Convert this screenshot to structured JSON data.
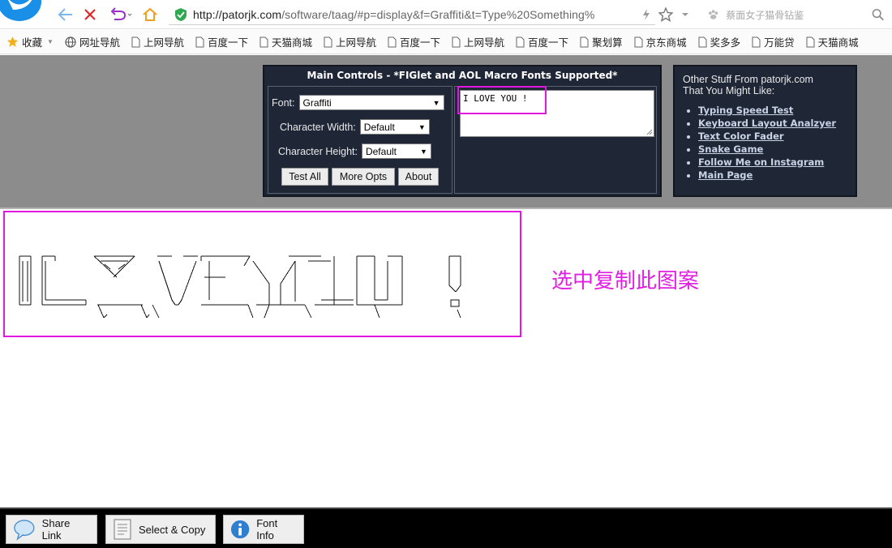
{
  "browser": {
    "url_host": "http://patorjk.com",
    "url_rest": "/software/taag/#p=display&f=Graffiti&t=Type%20Something%",
    "search_placeholder": "蔡面女子猫骨钻鉴"
  },
  "bookmarks": [
    {
      "label": "收藏",
      "icon": "star-icon"
    },
    {
      "label": "网址导航",
      "icon": "globe-icon"
    },
    {
      "label": "上网导航",
      "icon": "page-icon"
    },
    {
      "label": "百度一下",
      "icon": "page-icon"
    },
    {
      "label": "天猫商城",
      "icon": "page-icon"
    },
    {
      "label": "上网导航",
      "icon": "page-icon"
    },
    {
      "label": "百度一下",
      "icon": "page-icon"
    },
    {
      "label": "上网导航",
      "icon": "page-icon"
    },
    {
      "label": "百度一下",
      "icon": "page-icon"
    },
    {
      "label": "聚划算",
      "icon": "page-icon"
    },
    {
      "label": "京东商城",
      "icon": "page-icon"
    },
    {
      "label": "奖多多",
      "icon": "page-icon"
    },
    {
      "label": "万能贷",
      "icon": "page-icon"
    },
    {
      "label": "天猫商城",
      "icon": "page-icon"
    }
  ],
  "controls": {
    "title": "Main Controls - *FIGlet and AOL Macro Fonts Supported*",
    "font_label": "Font:",
    "font_value": "Graffiti",
    "width_label": "Character Width:",
    "width_value": "Default",
    "height_label": "Character Height:",
    "height_value": "Default",
    "test_all": "Test All",
    "more_opts": "More Opts",
    "about": "About",
    "input_text": "I LOVE YOU !"
  },
  "other": {
    "intro_line1": "Other Stuff From patorjk.com",
    "intro_line2": "That You Might Like:",
    "links": [
      "Typing Speed Test",
      "Keyboard Layout Analzyer",
      "Text Color Fader",
      "Snake Game",
      "Follow Me on Instagram",
      "Main Page"
    ]
  },
  "annotation": "选中复制此图案",
  "bottom": {
    "share": "Share Link",
    "select_copy": "Select & Copy",
    "font_info": "Font Info"
  },
  "colors": {
    "highlight": "#e018e0",
    "panel": "#1f2737",
    "banner": "#8c8c8c"
  }
}
